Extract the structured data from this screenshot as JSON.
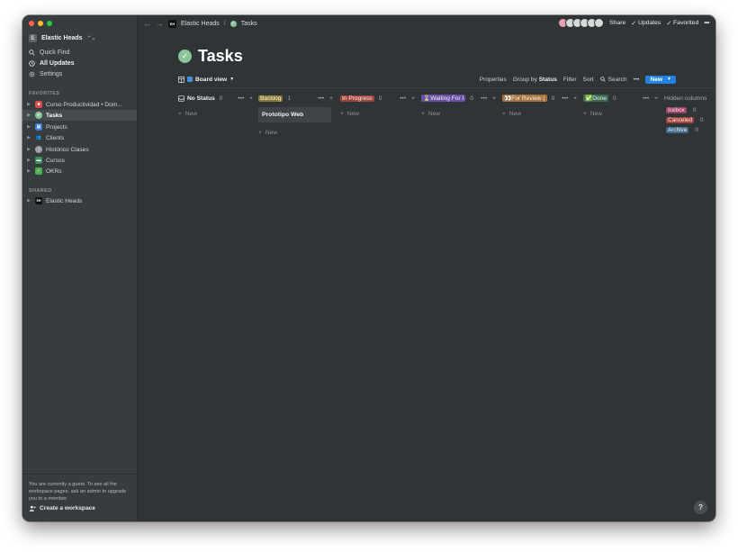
{
  "workspace": {
    "badge": "E",
    "name": "Elastic Heads"
  },
  "nav": [
    {
      "icon": "search-icon",
      "label": "Quick Find"
    },
    {
      "icon": "clock-icon",
      "label": "All Updates"
    },
    {
      "icon": "gear-icon",
      "label": "Settings"
    }
  ],
  "favorites_label": "FAVORITES",
  "favorites": [
    {
      "label": "Curso Productividad • Dom...",
      "icon_color": "#d94a4a"
    },
    {
      "label": "Tasks",
      "icon_color": "#8bc49a"
    },
    {
      "label": "Projects",
      "icon_color": "#3b7bd4"
    },
    {
      "label": "Clients",
      "icon_color": "#6b6f73"
    },
    {
      "label": "Histórico Clases",
      "icon_color": "#9aa0a4"
    },
    {
      "label": "Cursos",
      "icon_color": "#3a8f5a"
    },
    {
      "label": "OKRs",
      "icon_color": "#4caf50"
    }
  ],
  "shared_label": "SHARED",
  "shared": [
    {
      "label": "Elastic Heads",
      "badge": "EH"
    }
  ],
  "guest_message": "You are currently a guest. To see all the workspace pages, ask an admin to upgrade you to a member.",
  "create_workspace": "Create a workspace",
  "breadcrumb": {
    "workspace": "Elastic Heads",
    "badge": "EH",
    "separator": "/",
    "page": "Tasks"
  },
  "topbar": {
    "share": "Share",
    "updates": "Updates",
    "favorited": "Favorited"
  },
  "page_title": "Tasks",
  "view": {
    "name": "Board view"
  },
  "toolbar": {
    "properties": "Properties",
    "group_by": "Group by",
    "group_by_value": "Status",
    "filter": "Filter",
    "sort": "Sort",
    "search": "Search",
    "new": "New"
  },
  "columns": [
    {
      "label": "No Status",
      "count": "0",
      "color": "transparent",
      "new": "New",
      "cards": []
    },
    {
      "label": "Backlog",
      "count": "1",
      "color": "#8a7a2e",
      "new": "New",
      "cards": [
        "Prototipo Web"
      ]
    },
    {
      "label": "In Progress",
      "count": "0",
      "color": "#a3423b",
      "new": "New",
      "cards": []
    },
    {
      "label": "⌛Waiting For I",
      "count": "0",
      "color": "#6a4fa8",
      "new": "New",
      "cards": []
    },
    {
      "label": "👀For Review (",
      "count": "0",
      "color": "#a8733a",
      "new": "New",
      "cards": []
    },
    {
      "label": "✅Done",
      "count": "0",
      "color": "#3b6b4f",
      "new": "New",
      "cards": []
    }
  ],
  "hidden_columns": {
    "title": "Hidden columns",
    "items": [
      {
        "label": "Icebox",
        "count": "0",
        "color": "#a13f6a"
      },
      {
        "label": "Canceled",
        "count": "0",
        "color": "#a3423b"
      },
      {
        "label": "Archive",
        "count": "0",
        "color": "#3f6a8a"
      }
    ]
  },
  "help": "?"
}
